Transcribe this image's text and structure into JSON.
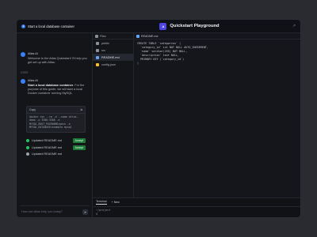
{
  "topbar": {
    "left_title": "Start a local database container",
    "app_badge": "A",
    "app_title": "Quickstart Playground",
    "expand_icon": "↗"
  },
  "chat": {
    "greeting": {
      "name": "Atlas AI",
      "text": "Welcome to the Atlas Quickstart! I'll help you get set up with Atlas."
    },
    "user_label": "USER",
    "reply": {
      "name": "Atlas AI",
      "bold": "Start a local database container",
      "text": ". For the purpose of this guide, we will start a local Docker container running MySQL."
    },
    "code": {
      "label": "Copy",
      "lines": [
        "docker run --rm -d --name atlas-",
        "demo -p 3306:3306 -e",
        "MYSQL_ROOT_PASSWORD=pass -e",
        "MYSQL_DATABASE=example mysql"
      ]
    },
    "updates": [
      {
        "text": "Updated README.md",
        "action": "Accept"
      },
      {
        "text": "Updated README.md",
        "action": "Accept"
      },
      {
        "text": "Updated README.md",
        "action": ""
      }
    ],
    "input_placeholder": "How can Atlas help you today?",
    "send_icon": "➤"
  },
  "files": {
    "header": "Files",
    "items": [
      {
        "name": "public",
        "type": "folder"
      },
      {
        "name": "src",
        "type": "folder"
      },
      {
        "name": "README.md",
        "type": "md",
        "active": true
      },
      {
        "name": "config.json",
        "type": "json"
      }
    ]
  },
  "editor": {
    "tab": "README.md",
    "code_lines": [
      "CREATE TABLE `categories` (",
      "  `category_id` int NOT NULL AUTO_INCREMENT,",
      "  `name` varchar(255) NOT NULL,",
      "  `description` text NULL,",
      "  PRIMARY KEY (`category_id`)",
      ")"
    ]
  },
  "terminal": {
    "tabs": [
      "Terminal",
      "+ New"
    ],
    "lines": [
      "~/project",
      "$"
    ]
  },
  "colors": {
    "accent": "#3b82f6",
    "accept": "#1f7a3a",
    "app_badge": "#4f46e5"
  }
}
